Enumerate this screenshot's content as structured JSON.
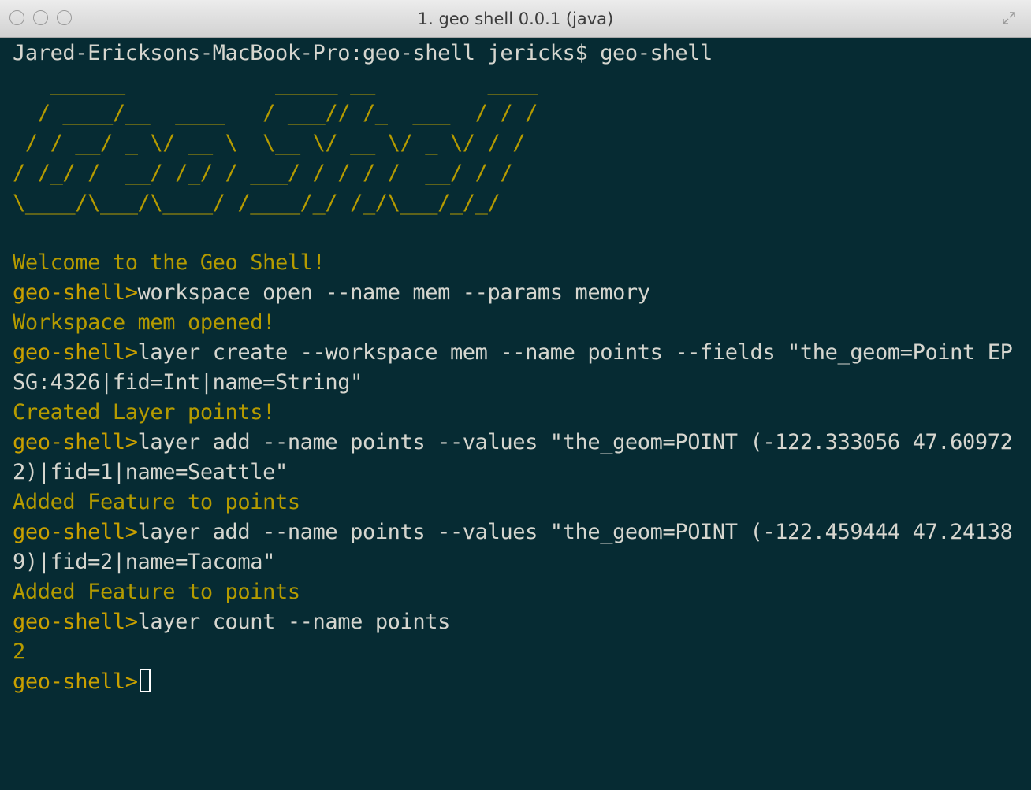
{
  "window": {
    "title": "1. geo shell 0.0.1 (java)"
  },
  "icons": {
    "close": "traffic-light-close",
    "minimize": "traffic-light-minimize",
    "zoom": "traffic-light-zoom",
    "fullscreen": "fullscreen-arrows-icon"
  },
  "colors": {
    "terminal_bg": "#062b33",
    "prompt": "#c9a000",
    "output": "#b59b00",
    "command_text": "#d6d6cf"
  },
  "terminal": {
    "shell_command_line": "Jared-Ericksons-MacBook-Pro:geo-shell jericks$ geo-shell",
    "banner": [
      "   ______            _____ __         ____",
      "  / ____/__  ____   / ___// /_  ___  / / /",
      " / / __/ _ \\/ __ \\  \\__ \\/ __ \\/ _ \\/ / / ",
      "/ /_/ /  __/ /_/ / ___/ / / / /  __/ / /  ",
      "\\____/\\___/\\____/ /____/_/ /_/\\___/_/_/   ",
      ""
    ],
    "welcome": "Welcome to the Geo Shell!",
    "prompt_label": "geo-shell>",
    "cmd1": "workspace open --name mem --params memory",
    "out1": "Workspace mem opened!",
    "cmd2_line1": "layer create --workspace mem --name points --fields \"the_geom=Point EP",
    "cmd2_line2": "SG:4326|fid=Int|name=String\"",
    "out2": "Created Layer points!",
    "cmd3_line1": "layer add --name points --values \"the_geom=POINT (-122.333056 47.60972",
    "cmd3_line2": "2)|fid=1|name=Seattle\"",
    "out3": "Added Feature to points",
    "cmd4_line1": "layer add --name points --values \"the_geom=POINT (-122.459444 47.24138",
    "cmd4_line2": "9)|fid=2|name=Tacoma\"",
    "out4": "Added Feature to points",
    "cmd5": "layer count --name points",
    "out5": "2"
  }
}
